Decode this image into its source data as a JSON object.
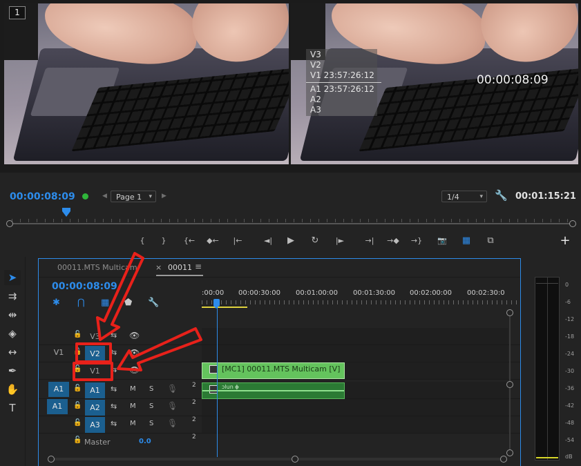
{
  "monitor": {
    "camera_number": "1",
    "track_overlay": {
      "video_rows": [
        "V3",
        "V2",
        "V1 23:57:26:12"
      ],
      "audio_rows": [
        "A1 23:57:26:12",
        "A2",
        "A3"
      ]
    },
    "overlay_timecode": "00:00:08:09",
    "current_timecode": "00:00:08:09",
    "page_select": "Page 1",
    "resolution_select": "1/4",
    "duration": "00:01:15:21",
    "playhead_fraction": 0.1
  },
  "transport": {
    "mark_in": "{",
    "mark_out": "}",
    "go_to_in": "{←",
    "add_marker": "◆←",
    "step_back_edit": "|←",
    "step_back": "◄|",
    "play": "▶",
    "loop": "↻",
    "step_forward": "|►",
    "step_forward_edit": "→|",
    "lift": "→◆",
    "go_to_out": "→}",
    "export_frame": "📷",
    "multicam": "▦",
    "compare": "⧉",
    "add": "+"
  },
  "tools": [
    "selection",
    "track-select",
    "ripple-edit",
    "razor",
    "slip",
    "pen",
    "hand",
    "type"
  ],
  "timeline": {
    "tabs": [
      {
        "label": "00011.MTS Multicam"
      },
      {
        "label": "00011",
        "active": true
      }
    ],
    "close_glyph": "×",
    "menu_glyph": "≡",
    "sequence_timecode": "00:00:08:09",
    "ruler_labels": [
      ":00:00",
      "00:00:30:00",
      "00:01:00:00",
      "00:01:30:00",
      "00:02:00:00",
      "00:02:30:0"
    ],
    "video_tracks": [
      {
        "name": "V3",
        "source": "",
        "targeted": false
      },
      {
        "name": "V2",
        "source": "V1",
        "targeted": true
      },
      {
        "name": "V1",
        "source": "",
        "targeted": false
      }
    ],
    "audio_tracks": [
      {
        "name": "A1",
        "source": "A1",
        "targeted": true,
        "m": "M",
        "s": "S",
        "channels": "2"
      },
      {
        "name": "A2",
        "source": "",
        "targeted": true,
        "m": "M",
        "s": "S",
        "channels": "2"
      },
      {
        "name": "A3",
        "source": "",
        "targeted": true,
        "m": "M",
        "s": "S",
        "channels": "2"
      }
    ],
    "master_label": "Master",
    "master_value": "0.0",
    "master_channels": "2",
    "video_clip": "[MC1] 00011.MTS Multicam [V]",
    "audio_clip_hint": "ɔ͏lun ɸ̶",
    "playhead_fraction": 0.055
  },
  "meters": {
    "scale": [
      "0",
      "-6",
      "-12",
      "-18",
      "-24",
      "-30",
      "-36",
      "-42",
      "-48",
      "-54",
      "dB"
    ]
  },
  "colors": {
    "accent_blue": "#2d8ceb",
    "annotation_red": "#e8211a",
    "clip_green": "#64c35d",
    "target_blue": "#1b5f8f"
  }
}
